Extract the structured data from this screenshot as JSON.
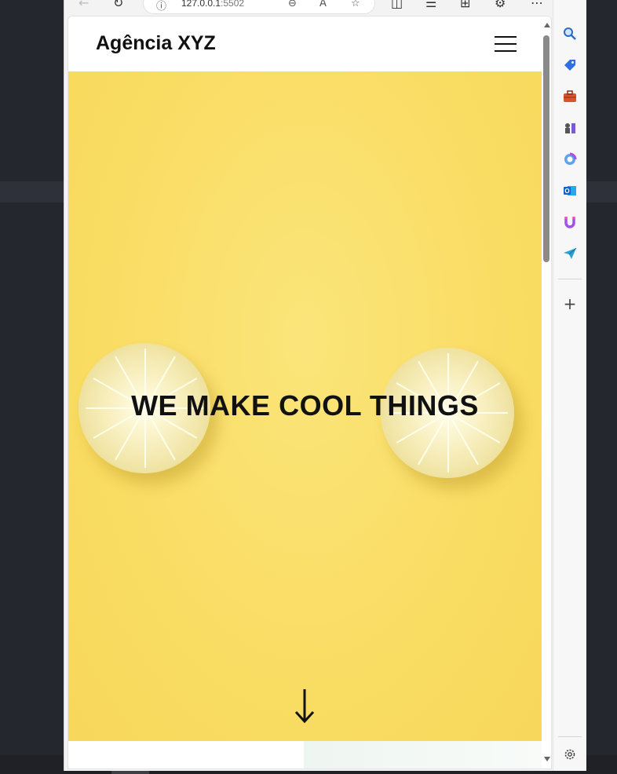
{
  "browser": {
    "address_info_icon": "info-icon",
    "url_host": "127.0.0.1",
    "url_port": ":5502"
  },
  "site": {
    "brand": "Agência XYZ",
    "menu_icon": "hamburger-menu-icon"
  },
  "hero": {
    "title": "WE MAKE COOL THINGS",
    "scroll_icon": "arrow-down-icon"
  },
  "sidebar": {
    "items": [
      "search-icon",
      "tag-icon",
      "briefcase-icon",
      "chess-icon",
      "copilot-icon",
      "outlook-icon",
      "magnet-icon",
      "send-icon"
    ],
    "add_label": "+",
    "settings_icon": "gear-icon"
  },
  "colors": {
    "hero_bg": "#f9dc63",
    "brand_text": "#111111",
    "accent_outlook": "#0a64d6"
  }
}
